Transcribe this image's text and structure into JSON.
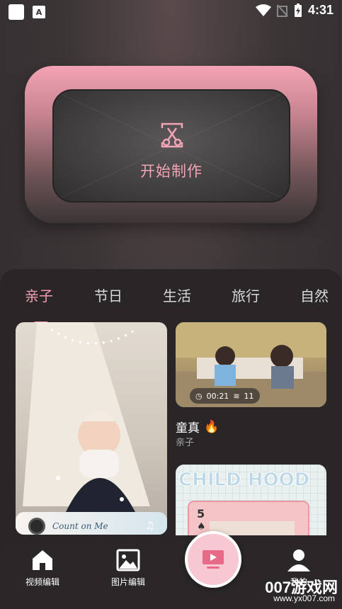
{
  "status_bar": {
    "time": "4:31",
    "icons": [
      "app-square-icon",
      "a-badge-icon",
      "wifi-icon",
      "no-signal-icon",
      "battery-charging-icon"
    ]
  },
  "hero": {
    "label": "开始制作",
    "icon": "scissors-frame-icon",
    "accent": "#f2a3b5"
  },
  "tabs": [
    {
      "label": "亲子",
      "active": true
    },
    {
      "label": "节日"
    },
    {
      "label": "生活"
    },
    {
      "label": "旅行"
    },
    {
      "label": "自然"
    }
  ],
  "cards": {
    "left": {
      "overlay_text": "Count on Me"
    },
    "right1": {
      "duration": "00:21",
      "layers": "11",
      "title": "童真",
      "title_icon": "fire-icon",
      "subtitle": "亲子"
    },
    "right2": {
      "art_text": "CHILD HOOD",
      "card_number": "5"
    }
  },
  "bottom_nav": {
    "items": [
      {
        "label": "视频编辑",
        "icon": "home-icon"
      },
      {
        "label": "图片编辑",
        "icon": "image-icon"
      },
      {
        "label": "",
        "icon": "play-screen-icon"
      },
      {
        "label": "我的",
        "icon": "user-icon"
      }
    ]
  },
  "watermark": {
    "main": "007游戏网",
    "sub": "www.yx007.com"
  },
  "colors": {
    "accent_pink": "#f59bb0",
    "panel_bg": "#2a2627"
  }
}
